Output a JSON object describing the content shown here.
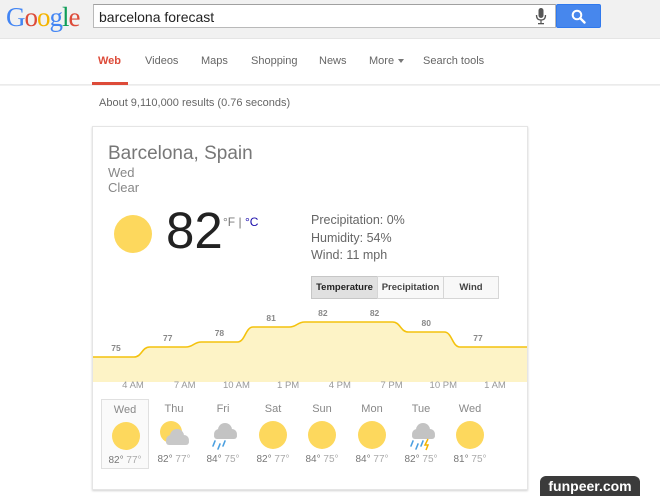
{
  "logo": {
    "letters": [
      "G",
      "o",
      "o",
      "g",
      "l",
      "e"
    ],
    "colors": [
      "#4285f4",
      "#dd4b39",
      "#f4b400",
      "#4285f4",
      "#0f9d58",
      "#dd4b39"
    ]
  },
  "search": {
    "query": "barcelona forecast",
    "mic_icon": "mic-icon",
    "button_icon": "magnifier-icon"
  },
  "tabs": [
    "Web",
    "Videos",
    "Maps",
    "Shopping",
    "News",
    "More",
    "Search tools"
  ],
  "active_tab": "Web",
  "result_stats": "About 9,110,000 results (0.76 seconds)",
  "weather": {
    "location": "Barcelona, Spain",
    "day": "Wed",
    "condition": "Clear",
    "temperature": "82",
    "unit_f": "°F",
    "unit_sep": "|",
    "unit_c": "°C",
    "precipitation": "Precipitation: 0%",
    "humidity": "Humidity: 54%",
    "wind": "Wind: 11 mph",
    "toggle": [
      "Temperature",
      "Precipitation",
      "Wind"
    ],
    "toggle_selected": "Temperature"
  },
  "chart_data": {
    "type": "area",
    "x": [
      "4 AM",
      "7 AM",
      "10 AM",
      "1 PM",
      "4 PM",
      "7 PM",
      "10 PM",
      "1 AM"
    ],
    "points": [
      {
        "label": "75",
        "value": 75
      },
      {
        "label": "77",
        "value": 77
      },
      {
        "label": "78",
        "value": 78
      },
      {
        "label": "81",
        "value": 81
      },
      {
        "label": "82",
        "value": 82
      },
      {
        "label": "82",
        "value": 82
      },
      {
        "label": "80",
        "value": 80
      },
      {
        "label": "77",
        "value": 77
      }
    ],
    "line_color": "#f4c20d",
    "fill_color": "#fdf3c6"
  },
  "forecast": [
    {
      "day": "Wed",
      "icon": "sun-icon",
      "hi": "82°",
      "lo": "77°"
    },
    {
      "day": "Thu",
      "icon": "partly-cloudy-icon",
      "hi": "82°",
      "lo": "77°"
    },
    {
      "day": "Fri",
      "icon": "rain-icon",
      "hi": "84°",
      "lo": "75°"
    },
    {
      "day": "Sat",
      "icon": "sun-icon",
      "hi": "82°",
      "lo": "77°"
    },
    {
      "day": "Sun",
      "icon": "sun-icon",
      "hi": "84°",
      "lo": "75°"
    },
    {
      "day": "Mon",
      "icon": "sun-icon",
      "hi": "84°",
      "lo": "77°"
    },
    {
      "day": "Tue",
      "icon": "storm-icon",
      "hi": "82°",
      "lo": "75°"
    },
    {
      "day": "Wed",
      "icon": "sun-icon",
      "hi": "81°",
      "lo": "75°"
    }
  ],
  "watermark": "funpeer.com"
}
